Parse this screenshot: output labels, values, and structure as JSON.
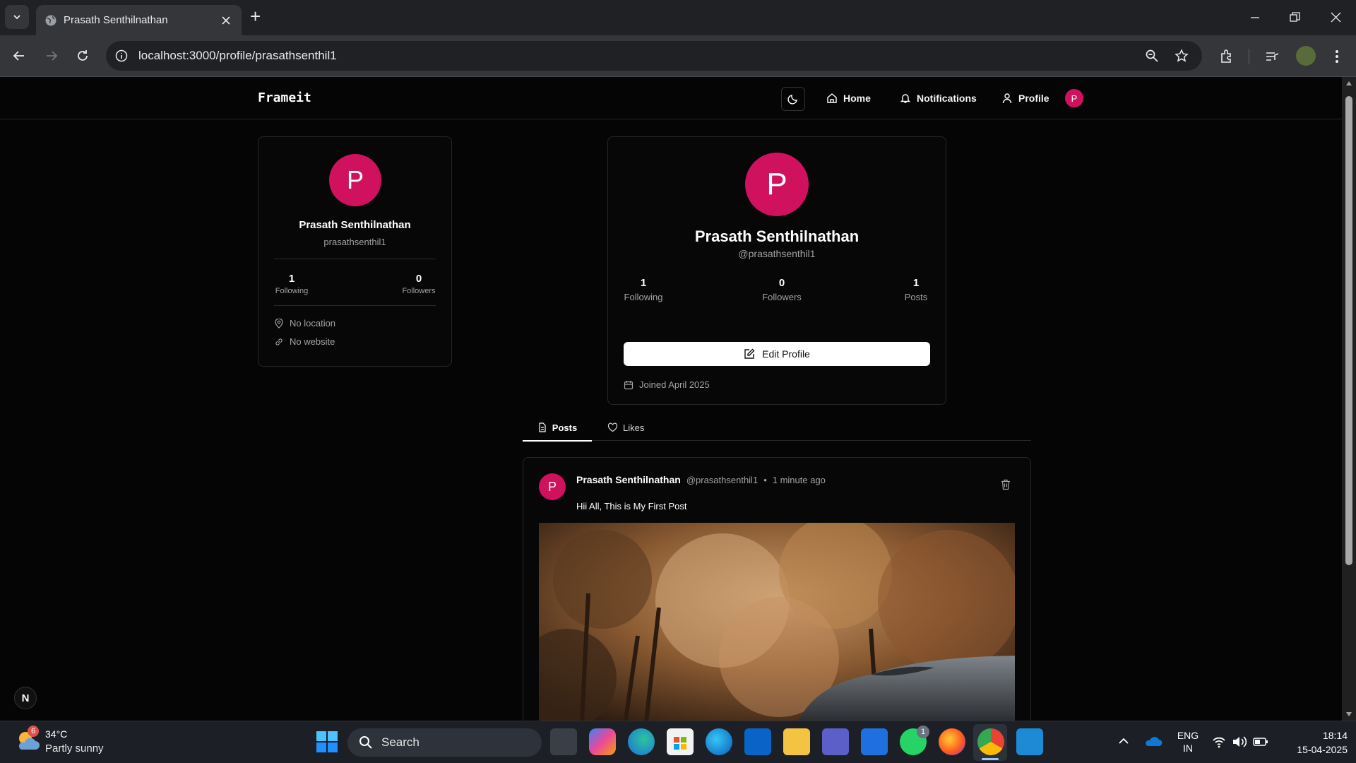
{
  "browser": {
    "tab_title": "Prasath Senthilnathan",
    "new_tab": "+",
    "url": "localhost:3000/profile/prasathsenthil1"
  },
  "navbar": {
    "brand": "Frameit",
    "home": "Home",
    "notifications": "Notifications",
    "profile": "Profile",
    "avatar_letter": "P"
  },
  "sidebar_card": {
    "avatar_letter": "P",
    "name": "Prasath Senthilnathan",
    "username": "prasathsenthil1",
    "following_count": "1",
    "following_label": "Following",
    "followers_count": "0",
    "followers_label": "Followers",
    "location": "No location",
    "website": "No website"
  },
  "profile_card": {
    "avatar_letter": "P",
    "name": "Prasath Senthilnathan",
    "handle": "@prasathsenthil1",
    "following_count": "1",
    "following_label": "Following",
    "followers_count": "0",
    "followers_label": "Followers",
    "posts_count": "1",
    "posts_label": "Posts",
    "edit_button": "Edit Profile",
    "joined": "Joined April 2025"
  },
  "tabs": {
    "posts": "Posts",
    "likes": "Likes"
  },
  "post": {
    "avatar_letter": "P",
    "author": "Prasath Senthilnathan",
    "handle": "@prasathsenthil1",
    "separator": "•",
    "time": "1 minute ago",
    "content": "Hii All, This is My First Post"
  },
  "nextjs_badge": "N",
  "taskbar": {
    "weather_badge": "6",
    "temperature": "34°C",
    "weather": "Partly sunny",
    "search": "Search",
    "whatsapp_badge": "1",
    "lang_line1": "ENG",
    "lang_line2": "IN",
    "time": "18:14",
    "date": "15-04-2025"
  },
  "colors": {
    "accent": "#d0115e",
    "chrome_bg": "#202124",
    "toolbar_bg": "#35363a",
    "page_bg": "#050505",
    "taskbar_bg": "#1c2026"
  }
}
